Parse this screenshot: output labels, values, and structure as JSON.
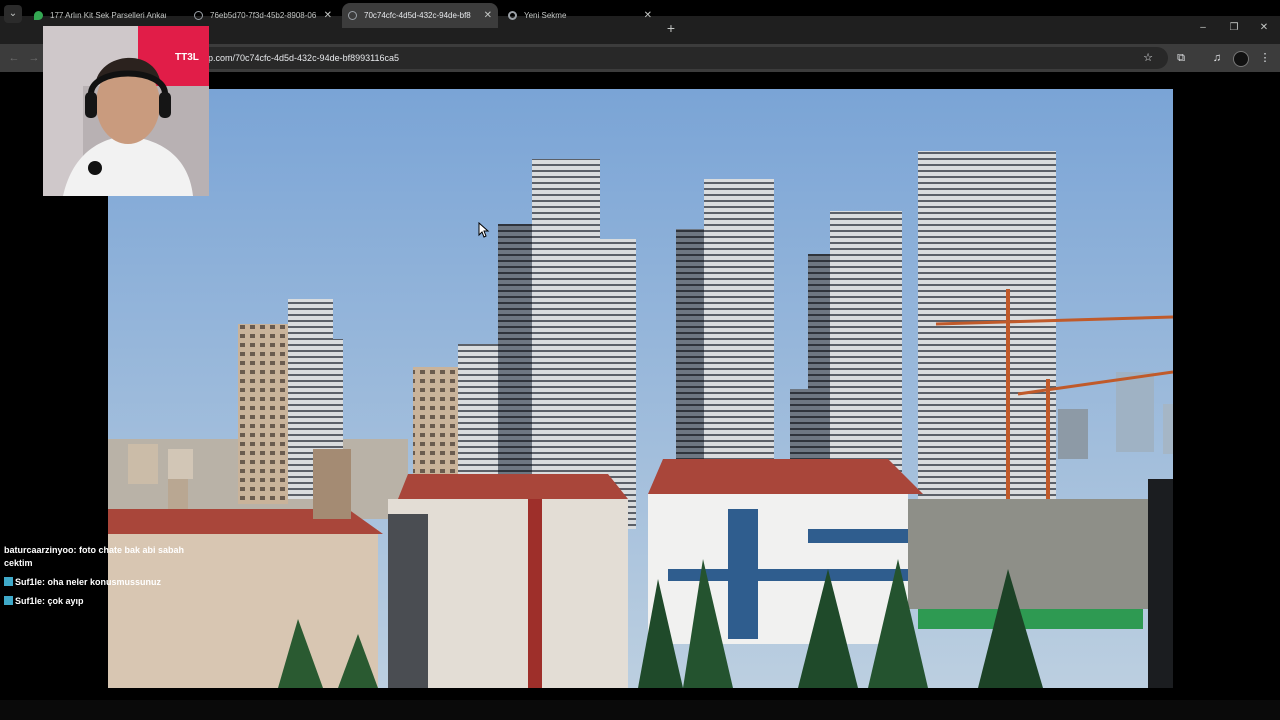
{
  "browser": {
    "tabs": [
      {
        "title": "177 Arlın Kit Sek Parselleri Ankara",
        "active": false,
        "favicon": "map-pin-icon",
        "favicon_color": "#34a853"
      },
      {
        "title": "76eb5d70-7f3d-45b2-8908-06",
        "active": false,
        "favicon": "globe-icon",
        "favicon_color": "#9aa0a6"
      },
      {
        "title": "70c74cfc-4d5d-432c-94de-bf8",
        "active": true,
        "favicon": "globe-icon",
        "favicon_color": "#9aa0a6"
      },
      {
        "title": "Yeni Sekme",
        "active": false,
        "favicon": "chrome-icon",
        "favicon_color": "#9aa0a6"
      }
    ],
    "tab_close_glyph": "✕",
    "new_tab_glyph": "+",
    "tab_list_glyph": "⌄",
    "window_controls": {
      "minimize": "–",
      "restore": "❐",
      "close": "✕"
    },
    "nav": {
      "back": "←",
      "forward": "→"
    },
    "address_url": "p.com/70c74cfc-4d5d-432c-94de-bf8993116ca5",
    "toolbar_icons": {
      "bookmark": "☆",
      "extensions": "⧉",
      "media": "♫",
      "menu": "⋮"
    }
  },
  "stream": {
    "chat": [
      {
        "user": "baturcaarzinyoo",
        "message": "foto chate bak abi sabah cektim",
        "badge": false
      },
      {
        "user": "Suf1le",
        "message": "oha neler konusmussunuz",
        "badge": true
      },
      {
        "user": "Suf1le",
        "message": "çok ayıp",
        "badge": true
      }
    ],
    "webcam_overlay_text": "TT3L"
  },
  "colors": {
    "sky_top": "#7fa8d8",
    "sky_bottom": "#b9cde0",
    "roof": "#a9463a",
    "chat_badge": "#3fa9c9"
  }
}
